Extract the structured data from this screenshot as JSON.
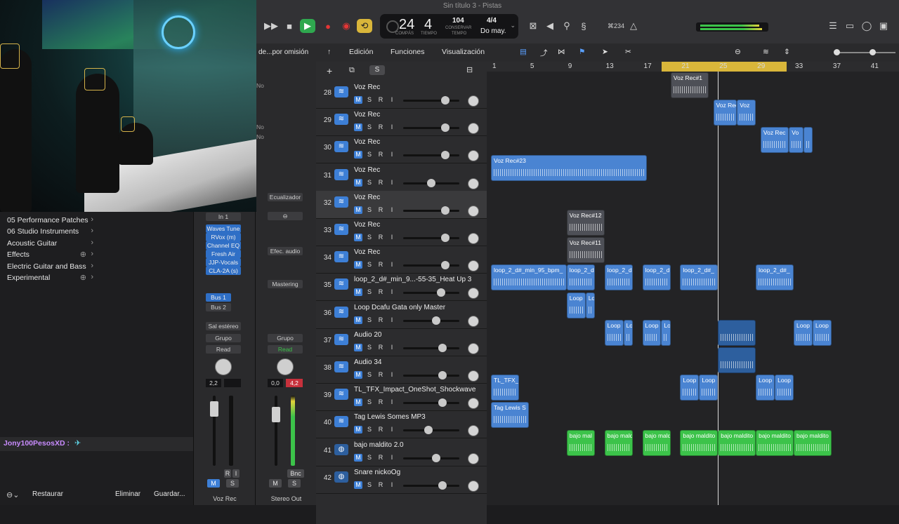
{
  "window": {
    "title": "Sin título 3 - Pistas"
  },
  "lcd": {
    "bar": "24",
    "beat": "4",
    "bar_label": "COMPÁS",
    "beat_label": "TIEMPO",
    "tempo": "104",
    "tempo_label": "CONSERVAR",
    "tempo_label2": "TEMPO",
    "signature": "4/4",
    "key": "Do may."
  },
  "toolbar_right": {
    "count": "⌘234"
  },
  "inspector": {
    "menu_label": "de...por omisión",
    "values": [
      "No",
      "No",
      "No"
    ]
  },
  "library": {
    "items": [
      {
        "label": "05 Performance Patches"
      },
      {
        "label": "06 Studio Instruments"
      },
      {
        "label": "Acoustic Guitar"
      },
      {
        "label": "Effects"
      },
      {
        "label": "Electric Guitar and Bass"
      },
      {
        "label": "Experimental"
      }
    ],
    "user": "Jony100PesosXD :",
    "buttons": {
      "restore": "Restaurar",
      "delete": "Eliminar",
      "save": "Guardar..."
    }
  },
  "strip1": {
    "input": "In 1",
    "plugins": [
      "Waves Tune",
      "RVox (m)",
      "Channel EQ",
      "Fresh Air",
      "JJP-Vocals",
      "CLA-2A (s)"
    ],
    "sends": [
      "Bus 1",
      "Bus 2"
    ],
    "output": "Sal estéreo",
    "group": "Grupo",
    "automation": "Read",
    "pan_value": "2,2",
    "name": "Voz Rec"
  },
  "strip2": {
    "eq": "Ecualizador",
    "fx": "Efec. audio",
    "mastering": "Mastering",
    "group": "Grupo",
    "automation": "Read",
    "value_left": "0,0",
    "value_right": "4,2",
    "bounce": "Bnc",
    "name": "Stereo Out"
  },
  "track_menu": {
    "edit": "Edición",
    "functions": "Funciones",
    "view": "Visualización"
  },
  "ruler": {
    "marks": [
      "1",
      "5",
      "9",
      "13",
      "17",
      "21",
      "25",
      "29",
      "33",
      "37",
      "41"
    ]
  },
  "tracks": [
    {
      "num": "28",
      "name": "Voz Rec",
      "icon": "waveform-icon",
      "level": 0.8
    },
    {
      "num": "29",
      "name": "Voz Rec",
      "icon": "waveform-icon",
      "level": 0.8
    },
    {
      "num": "30",
      "name": "Voz Rec",
      "icon": "waveform-icon",
      "level": 0.8
    },
    {
      "num": "31",
      "name": "Voz Rec",
      "icon": "waveform-icon",
      "level": 0.5
    },
    {
      "num": "32",
      "name": "Voz Rec",
      "icon": "waveform-icon",
      "level": 0.8
    },
    {
      "num": "33",
      "name": "Voz Rec",
      "icon": "waveform-icon",
      "level": 0.8
    },
    {
      "num": "34",
      "name": "Voz Rec",
      "icon": "waveform-icon",
      "level": 0.8
    },
    {
      "num": "35",
      "name": "loop_2_d#_min_9...-55-35_Heat Up 3",
      "icon": "waveform-icon",
      "level": 0.7
    },
    {
      "num": "36",
      "name": "Loop Dcafu Gata only Master",
      "icon": "waveform-icon",
      "level": 0.6
    },
    {
      "num": "37",
      "name": "Audio 20",
      "icon": "waveform-icon",
      "level": 0.74
    },
    {
      "num": "38",
      "name": "Audio 34",
      "icon": "waveform-icon",
      "level": 0.74
    },
    {
      "num": "39",
      "name": "TL_TFX_Impact_OneShot_Shockwave",
      "icon": "waveform-icon",
      "level": 0.74
    },
    {
      "num": "40",
      "name": "Tag Lewis Somes MP3",
      "icon": "waveform-icon",
      "level": 0.44
    },
    {
      "num": "41",
      "name": "bajo maldito 2.0",
      "icon": "drum-icon",
      "level": 0.6
    },
    {
      "num": "42",
      "name": "Snare nickoOg",
      "icon": "drum-icon",
      "level": 0.74
    }
  ],
  "regions": [
    {
      "row": 0,
      "start": 20,
      "end": 24,
      "label": "Voz Rec#1",
      "color": "gray"
    },
    {
      "row": 1,
      "start": 24.5,
      "end": 27,
      "label": "Voz Rec",
      "color": "blue"
    },
    {
      "row": 1,
      "start": 27,
      "end": 29,
      "label": "Voz",
      "color": "blue"
    },
    {
      "row": 2,
      "start": 29.5,
      "end": 32.5,
      "label": "Voz Rec",
      "color": "blue"
    },
    {
      "row": 2,
      "start": 32.5,
      "end": 34,
      "label": "Vo",
      "color": "blue"
    },
    {
      "row": 2,
      "start": 34,
      "end": 35,
      "label": "",
      "color": "blue"
    },
    {
      "row": 3,
      "start": 1,
      "end": 17.5,
      "label": "Voz Rec#23",
      "color": "blue"
    },
    {
      "row": 5,
      "start": 9,
      "end": 13,
      "label": "Voz Rec#12",
      "color": "gray"
    },
    {
      "row": 6,
      "start": 9,
      "end": 13,
      "label": "Voz Rec#11",
      "color": "gray"
    },
    {
      "row": 7,
      "start": 1,
      "end": 9,
      "label": "loop_2_d#_min_95_bpm_",
      "color": "blue"
    },
    {
      "row": 7,
      "start": 9,
      "end": 12,
      "label": "loop_2_d",
      "color": "blue"
    },
    {
      "row": 7,
      "start": 13,
      "end": 16,
      "label": "loop_2_d",
      "color": "blue"
    },
    {
      "row": 7,
      "start": 17,
      "end": 20,
      "label": "loop_2_d",
      "color": "blue"
    },
    {
      "row": 7,
      "start": 21,
      "end": 25,
      "label": "loop_2_d#_",
      "color": "blue"
    },
    {
      "row": 7,
      "start": 29,
      "end": 33,
      "label": "loop_2_d#_",
      "color": "blue"
    },
    {
      "row": 8,
      "start": 9,
      "end": 11,
      "label": "Loop",
      "color": "blue"
    },
    {
      "row": 8,
      "start": 11,
      "end": 12,
      "label": "Lo",
      "color": "blue"
    },
    {
      "row": 9,
      "start": 13,
      "end": 15,
      "label": "Loop",
      "color": "blue"
    },
    {
      "row": 9,
      "start": 15,
      "end": 16,
      "label": "Lo",
      "color": "blue"
    },
    {
      "row": 9,
      "start": 17,
      "end": 19,
      "label": "Loop",
      "color": "blue"
    },
    {
      "row": 9,
      "start": 19,
      "end": 20,
      "label": "Lo",
      "color": "blue"
    },
    {
      "row": 9,
      "start": 25,
      "end": 29,
      "label": "",
      "color": "navy"
    },
    {
      "row": 9,
      "start": 33,
      "end": 35,
      "label": "Loop",
      "color": "blue"
    },
    {
      "row": 9,
      "start": 35,
      "end": 37,
      "label": "Loop",
      "color": "blue"
    },
    {
      "row": 10,
      "start": 25,
      "end": 29,
      "label": "",
      "color": "navy"
    },
    {
      "row": 11,
      "start": 1,
      "end": 4,
      "label": "TL_TFX_I",
      "color": "blue"
    },
    {
      "row": 11,
      "start": 21,
      "end": 23,
      "label": "Loop",
      "color": "blue"
    },
    {
      "row": 11,
      "start": 23,
      "end": 25,
      "label": "Loop",
      "color": "blue"
    },
    {
      "row": 11,
      "start": 29,
      "end": 31,
      "label": "Loop",
      "color": "blue"
    },
    {
      "row": 11,
      "start": 31,
      "end": 33,
      "label": "Loop",
      "color": "blue"
    },
    {
      "row": 12,
      "start": 1,
      "end": 5,
      "label": "Tag Lewis S",
      "color": "blue"
    },
    {
      "row": 13,
      "start": 9,
      "end": 12,
      "label": "bajo mal",
      "color": "green"
    },
    {
      "row": 13,
      "start": 13,
      "end": 16,
      "label": "bajo mald",
      "color": "green"
    },
    {
      "row": 13,
      "start": 17,
      "end": 20,
      "label": "bajo mald",
      "color": "green"
    },
    {
      "row": 13,
      "start": 21,
      "end": 25,
      "label": "bajo maldito",
      "color": "green"
    },
    {
      "row": 13,
      "start": 25,
      "end": 29,
      "label": "bajo maldito",
      "color": "green"
    },
    {
      "row": 13,
      "start": 29,
      "end": 33,
      "label": "bajo maldito",
      "color": "green"
    },
    {
      "row": 13,
      "start": 33,
      "end": 37,
      "label": "bajo maldito",
      "color": "green"
    }
  ],
  "colors": {
    "accent": "#3d7fd6",
    "region_blue": "#4a84d2",
    "region_green": "#3cc34a",
    "cycle": "#d9b63a"
  }
}
